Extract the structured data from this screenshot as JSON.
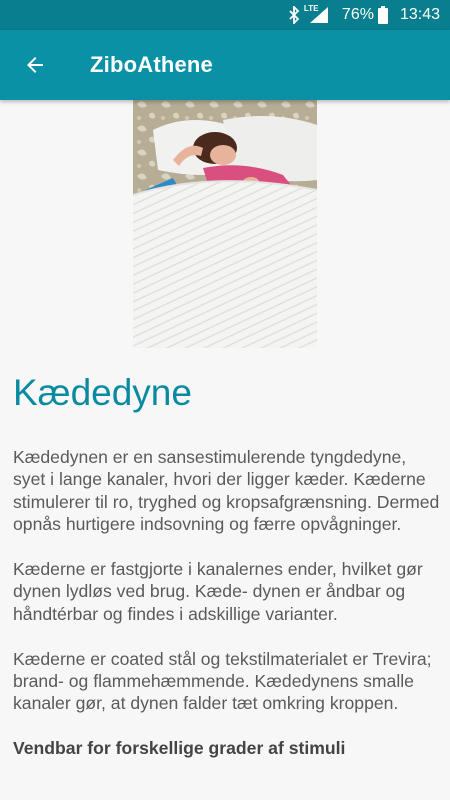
{
  "status": {
    "network": "LTE",
    "battery": "76%",
    "time": "13:43"
  },
  "appbar": {
    "title": "ZiboAthene"
  },
  "article": {
    "heading": "Kædedyne",
    "paragraphs": [
      "Kædedynen er en sansestimulerende tyngdedyne, syet i lange kanaler, hvori der ligger kæder. Kæderne stimulerer til ro, tryghed og kropsafgrænsning. Dermed opnås hurtigere indsovning og færre opvågninger.",
      "Kæderne er fastgjorte i kanalernes ender, hvilket gør dynen lydløs ved brug. Kæde- dynen er åndbar og håndtérbar og findes i adskillige varianter.",
      "Kæderne er coated stål og tekstilmaterialet er Trevira;",
      "brand- og flammehæmmende. Kædedynens smalle kanaler gør, at dynen falder tæt omkring kroppen."
    ],
    "subheading": "Vendbar for forskellige grader af stimuli"
  },
  "colors": {
    "appbar": "#0a91a6",
    "statusbar": "#087e8f",
    "heading": "#0a8aa0"
  }
}
